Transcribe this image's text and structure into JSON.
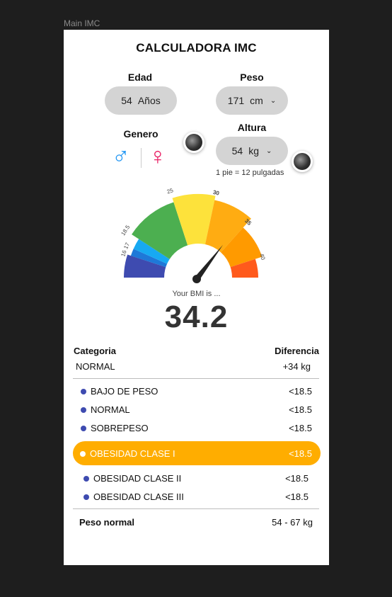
{
  "frame_label": "Main IMC",
  "title": "CALCULADORA IMC",
  "edad": {
    "label": "Edad",
    "value": "54",
    "unit": "Años"
  },
  "peso": {
    "label": "Peso",
    "value": "171",
    "unit": "cm"
  },
  "genero": {
    "label": "Genero",
    "male_symbol": "♂",
    "female_symbol": "♀"
  },
  "altura": {
    "label": "Altura",
    "value": "54",
    "unit": "kg",
    "hint": "1 pie = 12 pulgadas"
  },
  "gauge": {
    "ticks": [
      "16",
      "17",
      "18.5",
      "25",
      "30",
      "35",
      "40"
    ],
    "needle_value": 34.2,
    "colors": [
      "#3e4bb0",
      "#1e78d8",
      "#17a9f2",
      "#4caf50",
      "#fde23b",
      "#ffac12",
      "#ff9a00",
      "#ff5a1c"
    ]
  },
  "result": {
    "label": "Your BMI is ...",
    "value": "34.2"
  },
  "table": {
    "col_category": "Categoria",
    "col_difference": "Diferencia",
    "current": {
      "category": "NORMAL",
      "difference": "+34 kg"
    },
    "rows": [
      {
        "name": "BAJO DE PESO",
        "value": "<18.5"
      },
      {
        "name": "NORMAL",
        "value": "<18.5"
      },
      {
        "name": "SOBREPESO",
        "value": "<18.5"
      },
      {
        "name": "OBESIDAD CLASE I",
        "value": "<18.5",
        "highlighted": true
      },
      {
        "name": "OBESIDAD CLASE II",
        "value": "<18.5"
      },
      {
        "name": "OBESIDAD CLASE III",
        "value": "<18.5"
      }
    ],
    "normal_weight_label": "Peso normal",
    "normal_weight_value": "54 - 67 kg"
  },
  "accent_color": "#ffad00",
  "male_color": "#2196f3",
  "female_color": "#e91e63"
}
